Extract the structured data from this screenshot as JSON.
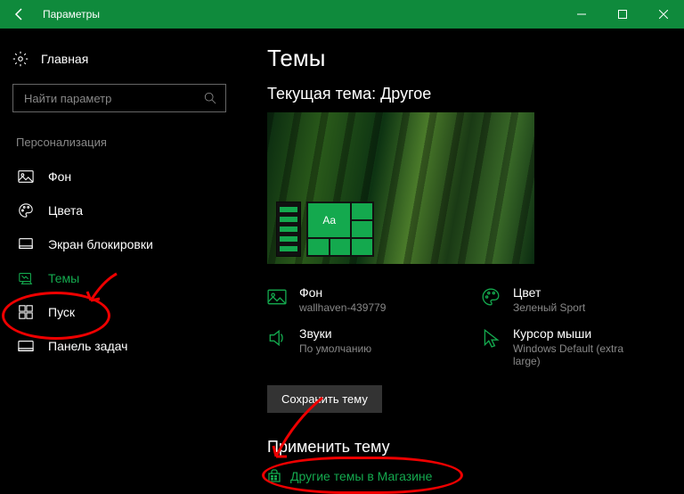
{
  "window": {
    "title": "Параметры"
  },
  "sidebar": {
    "home": "Главная",
    "search_placeholder": "Найти параметр",
    "section": "Персонализация",
    "items": [
      {
        "label": "Фон"
      },
      {
        "label": "Цвета"
      },
      {
        "label": "Экран блокировки"
      },
      {
        "label": "Темы"
      },
      {
        "label": "Пуск"
      },
      {
        "label": "Панель задач"
      }
    ]
  },
  "main": {
    "heading": "Темы",
    "current_theme_label": "Текущая тема: Другое",
    "preview_tile_text": "Aa",
    "settings": {
      "background": {
        "label": "Фон",
        "value": "wallhaven-439779"
      },
      "color": {
        "label": "Цвет",
        "value": "Зеленый Sport"
      },
      "sounds": {
        "label": "Звуки",
        "value": "По умолчанию"
      },
      "cursor": {
        "label": "Курсор мыши",
        "value": "Windows Default (extra large)"
      }
    },
    "save_button": "Сохранить тему",
    "apply_heading": "Применить тему",
    "store_link": "Другие темы в Магазине"
  },
  "colors": {
    "accent": "#14a94e",
    "titlebar": "#0f8a3c"
  }
}
